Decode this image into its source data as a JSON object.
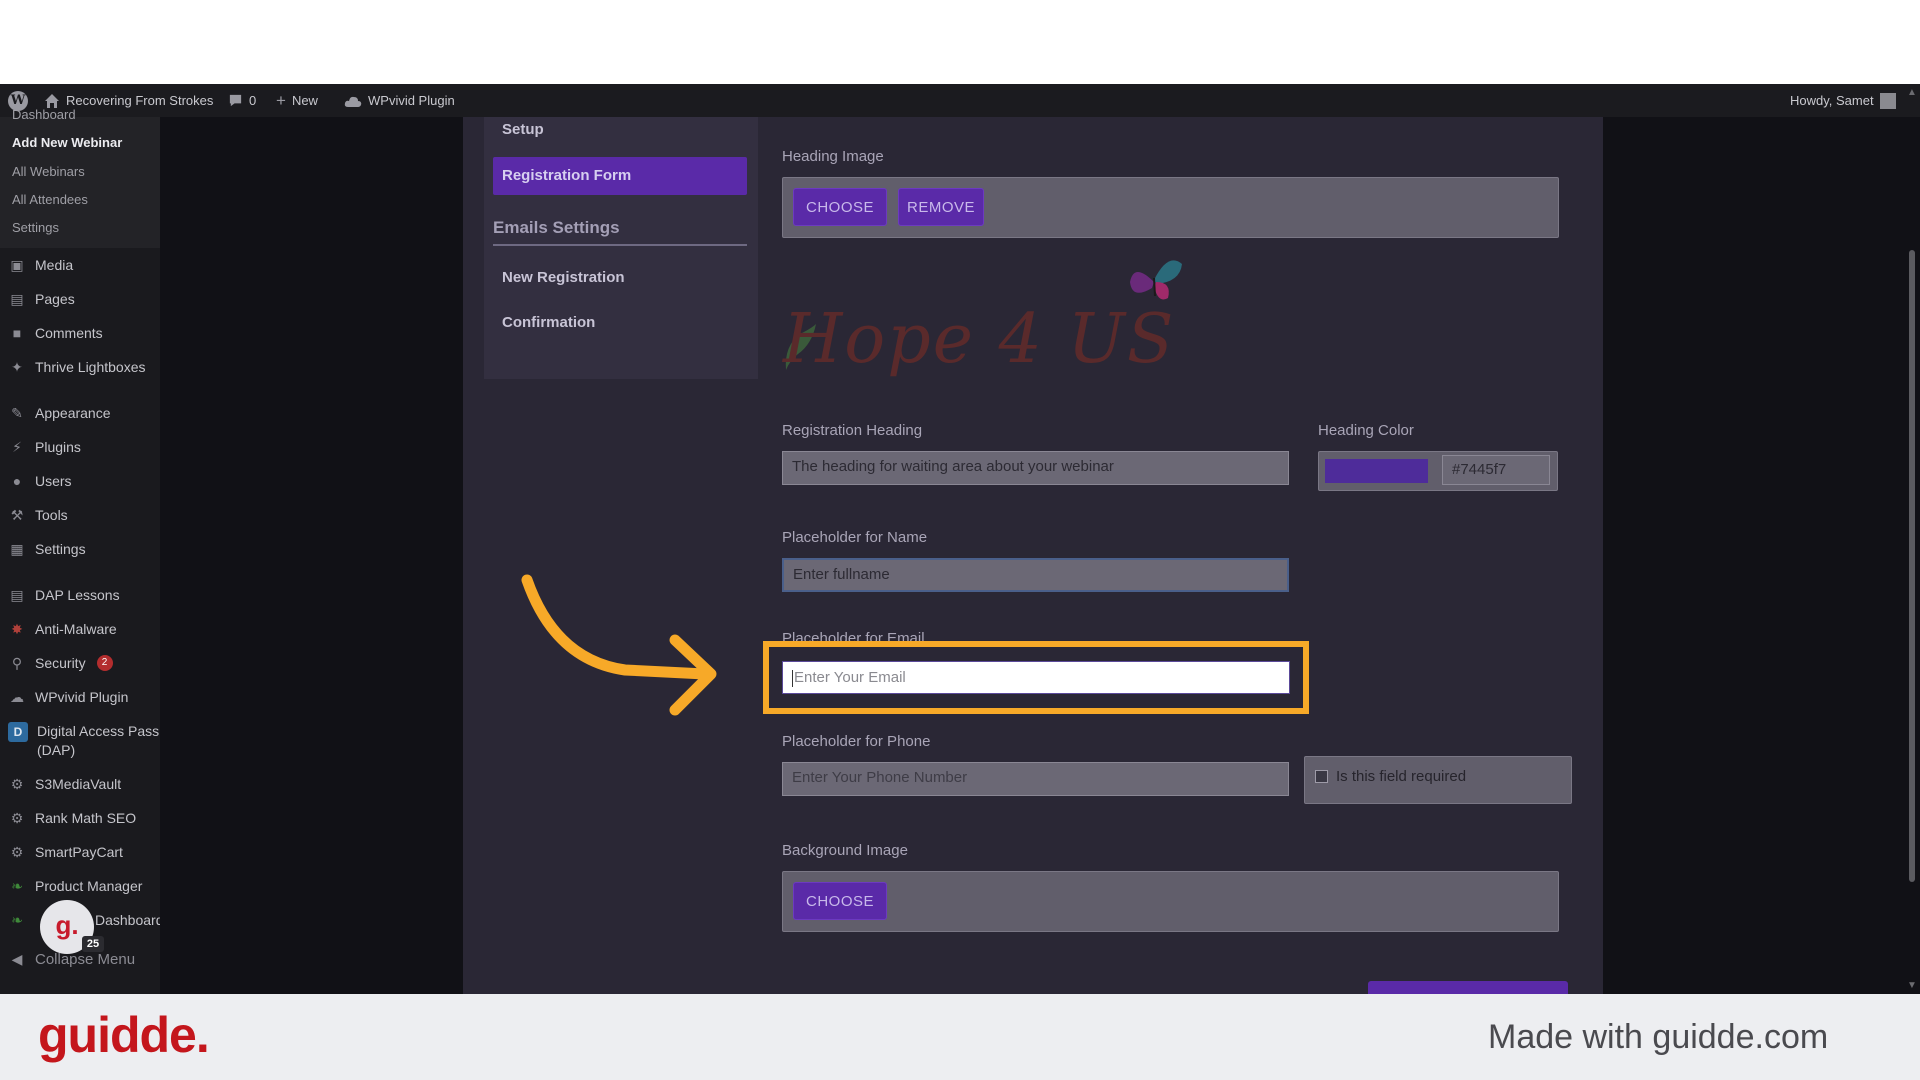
{
  "admin_bar": {
    "site_name": "Recovering From Strokes",
    "comments_count": "0",
    "new_label": "New",
    "plugin_label": "WPvivid Plugin",
    "howdy": "Howdy, Samet"
  },
  "sidebar": {
    "submenu": {
      "dashboard": "Dashboard",
      "add_new": "Add New Webinar",
      "all_webinars": "All Webinars",
      "all_attendees": "All Attendees",
      "settings": "Settings"
    },
    "items": [
      {
        "label": "Media",
        "icon": "media-icon"
      },
      {
        "label": "Pages",
        "icon": "pages-icon"
      },
      {
        "label": "Comments",
        "icon": "comments-icon"
      },
      {
        "label": "Thrive Lightboxes",
        "icon": "pin-icon"
      },
      {
        "label": "Appearance",
        "icon": "brush-icon"
      },
      {
        "label": "Plugins",
        "icon": "plugin-icon"
      },
      {
        "label": "Users",
        "icon": "user-icon"
      },
      {
        "label": "Tools",
        "icon": "wrench-icon"
      },
      {
        "label": "Settings",
        "icon": "settings-icon"
      },
      {
        "label": "DAP Lessons",
        "icon": "book-icon"
      },
      {
        "label": "Anti-Malware",
        "icon": "malware-icon"
      },
      {
        "label": "Security",
        "icon": "lock-icon",
        "badge": "2"
      },
      {
        "label": "WPvivid Plugin",
        "icon": "cloud-icon"
      },
      {
        "label": "Digital Access Pass",
        "label2": "(DAP)",
        "icon": "dap-icon"
      },
      {
        "label": "S3MediaVault",
        "icon": "gear-icon"
      },
      {
        "label": "Rank Math SEO",
        "icon": "gear-icon"
      },
      {
        "label": "SmartPayCart",
        "icon": "gear-icon"
      },
      {
        "label": "Product Manager",
        "icon": "leaf-icon"
      },
      {
        "label": "Dashboard",
        "icon": "leaf-icon"
      }
    ],
    "collapse": "Collapse Menu"
  },
  "settings_nav": {
    "setup": "Setup",
    "registration_form": "Registration Form",
    "emails_heading": "Emails Settings",
    "new_registration": "New Registration",
    "confirmation": "Confirmation"
  },
  "form": {
    "heading_image_label": "Heading Image",
    "choose": "CHOOSE",
    "remove": "REMOVE",
    "logo_text": "Hope 4 US",
    "registration_heading_label": "Registration Heading",
    "registration_heading_value": "The heading for waiting area about your webinar",
    "heading_color_label": "Heading Color",
    "heading_color_value": "#7445f7",
    "name_label": "Placeholder for Name",
    "name_value": "Enter fullname",
    "email_label": "Placeholder for Email",
    "email_value": "Enter Your Email",
    "phone_label": "Placeholder for Phone",
    "phone_value": "Enter Your Phone Number",
    "required_label": "Is this field required",
    "background_image_label": "Background Image",
    "choose2": "CHOOSE"
  },
  "overlay": {
    "avatar_letter": "g.",
    "avatar_badge": "25",
    "arrow_color": "#f7a928",
    "highlight_color": "#f7a928"
  },
  "footer": {
    "brand": "guidde.",
    "made_with": "Made with guidde.com"
  }
}
